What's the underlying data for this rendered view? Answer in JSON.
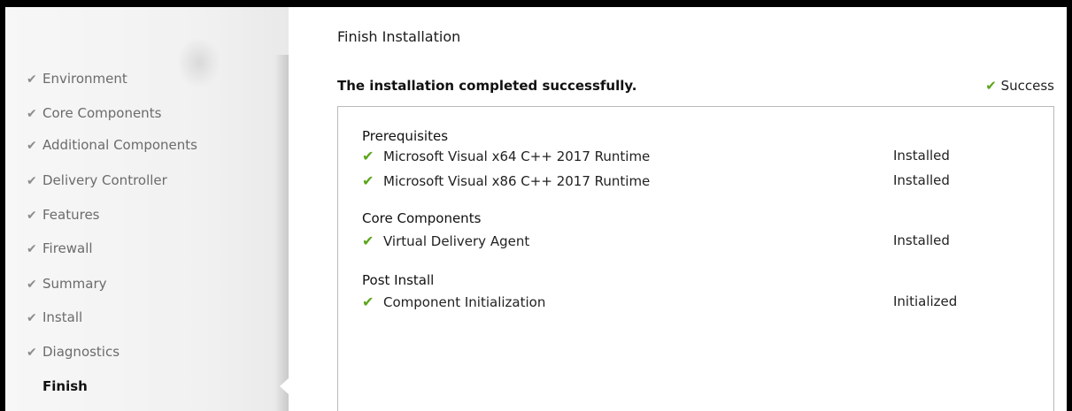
{
  "sidebar": {
    "items": [
      {
        "label": "Environment",
        "completed": true
      },
      {
        "label": "Core Components",
        "completed": true
      },
      {
        "label": "Additional Components",
        "completed": true
      },
      {
        "label": "Delivery Controller",
        "completed": true
      },
      {
        "label": "Features",
        "completed": true
      },
      {
        "label": "Firewall",
        "completed": true
      },
      {
        "label": "Summary",
        "completed": true
      },
      {
        "label": "Install",
        "completed": true
      },
      {
        "label": "Diagnostics",
        "completed": true
      },
      {
        "label": "Finish",
        "completed": false,
        "current": true
      }
    ]
  },
  "main": {
    "title": "Finish Installation",
    "status_message": "The installation completed successfully.",
    "status_label": "Success",
    "sections": [
      {
        "title": "Prerequisites",
        "rows": [
          {
            "name": "Microsoft Visual x64 C++ 2017 Runtime",
            "state": "Installed"
          },
          {
            "name": "Microsoft Visual x86 C++ 2017 Runtime",
            "state": "Installed"
          }
        ]
      },
      {
        "title": "Core Components",
        "rows": [
          {
            "name": "Virtual Delivery Agent",
            "state": "Installed"
          }
        ]
      },
      {
        "title": "Post Install",
        "rows": [
          {
            "name": "Component Initialization",
            "state": "Initialized"
          }
        ]
      }
    ]
  },
  "colors": {
    "success_green": "#5aa51a",
    "sidebar_text": "#6b6b6b",
    "panel_border": "#b9b9b9"
  },
  "icons": {
    "completed": "check-icon",
    "success": "green-check-icon"
  }
}
